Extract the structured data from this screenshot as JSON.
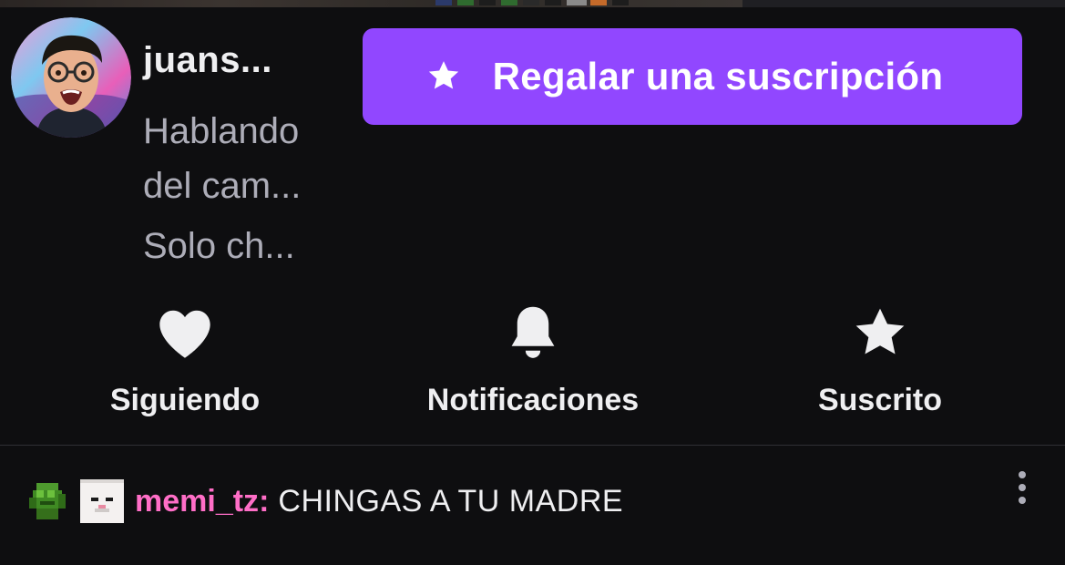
{
  "channel": {
    "name": "juans...",
    "title": "Hablando del cam...",
    "game": "Solo ch..."
  },
  "gift_button": {
    "label": "Regalar una suscripción",
    "icon": "star-icon"
  },
  "actions": [
    {
      "label": "Siguiendo",
      "icon": "heart-icon"
    },
    {
      "label": "Notificaciones",
      "icon": "bell-icon"
    },
    {
      "label": "Suscrito",
      "icon": "star-icon"
    }
  ],
  "chat": {
    "username": "memi_tz",
    "separator": ":",
    "message": "CHINGAS A TU MADRE",
    "badges": [
      "green-fist-badge",
      "white-face-badge"
    ],
    "username_color": "#ff6ec7"
  },
  "colors": {
    "background": "#0e0e10",
    "accent": "#9147ff",
    "muted_text": "#adadb8"
  }
}
